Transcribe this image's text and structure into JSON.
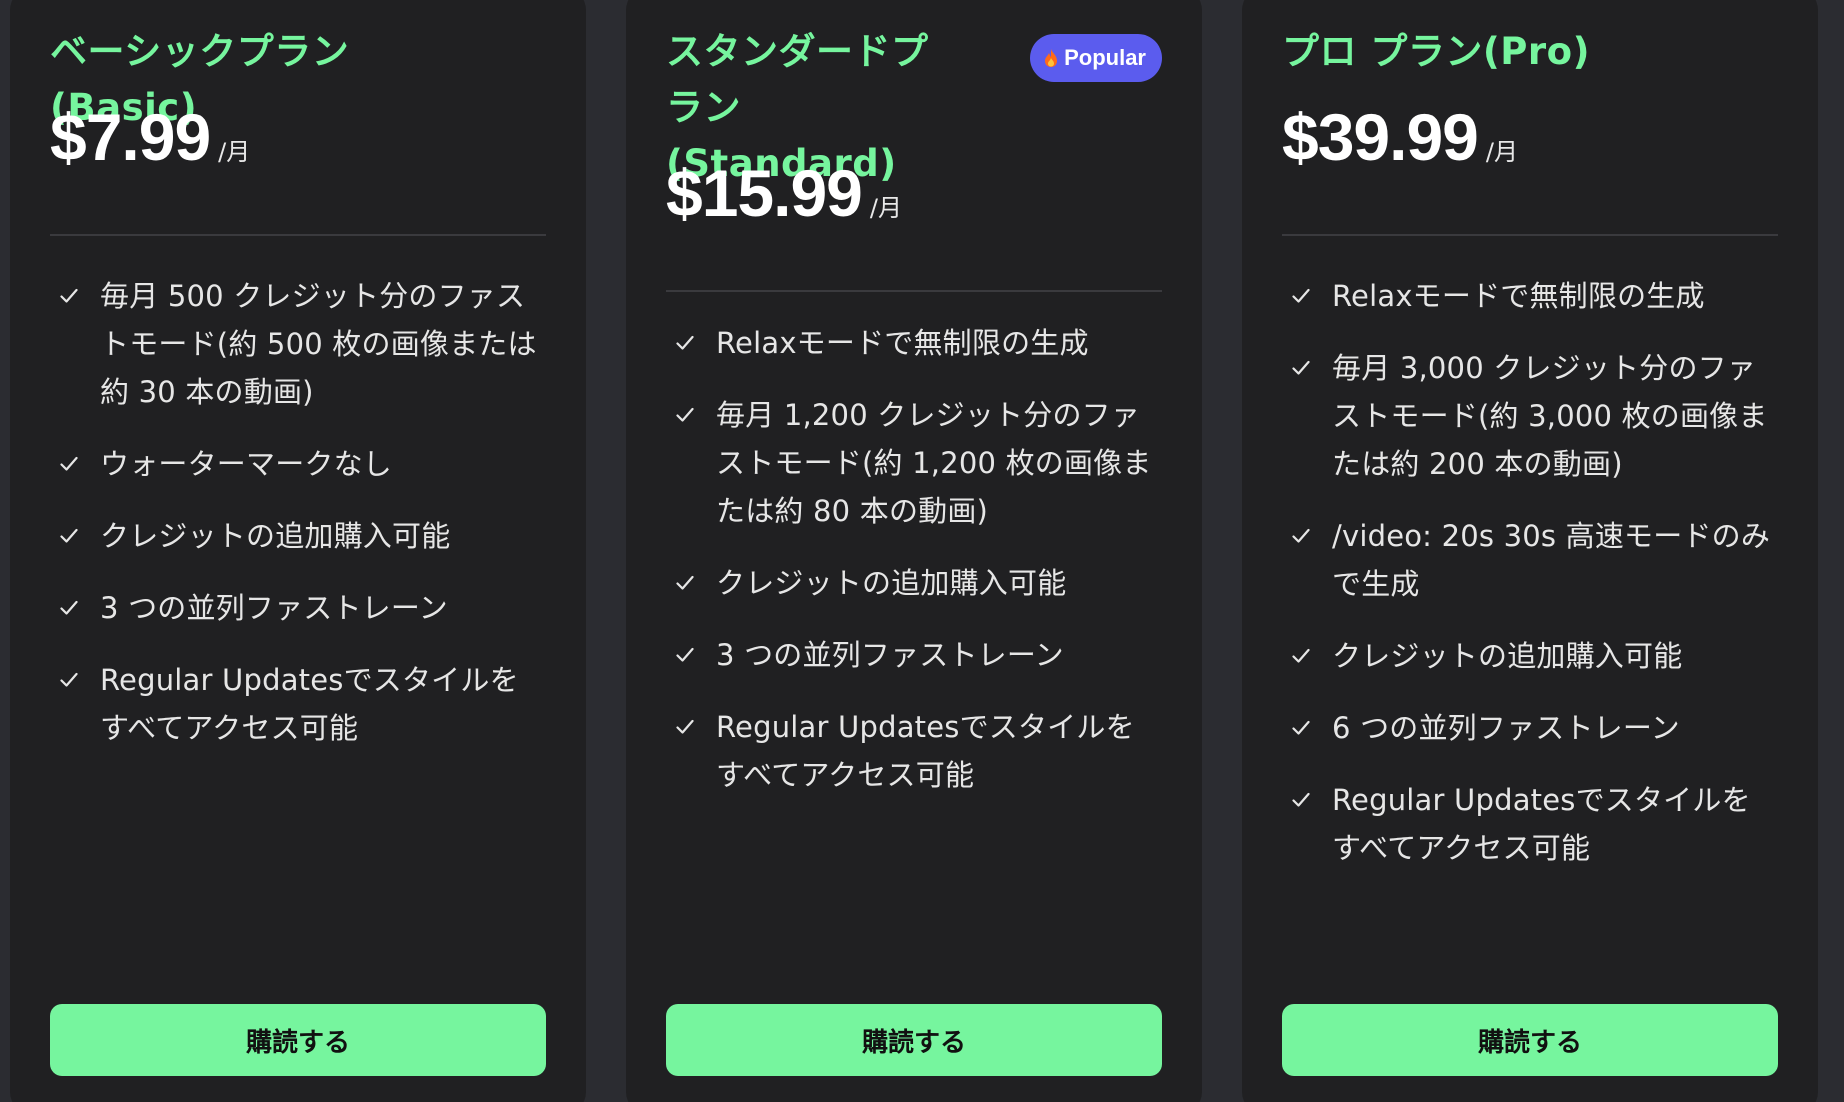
{
  "plans": [
    {
      "title": "ベーシックプラン(Basic)",
      "price": "$7.99",
      "per": "/月",
      "features": [
        "毎月 500 クレジット分のファストモード(約 500 枚の画像または約 30 本の動画)",
        "ウォーターマークなし",
        "クレジットの追加購入可能",
        "3 つの並列ファストレーン",
        "Regular Updatesでスタイルをすべてアクセス可能"
      ],
      "button": "購読する"
    },
    {
      "title": "スタンダードプラン(Standard)",
      "badge": "Popular",
      "badge_icon": "fire-icon",
      "price": "$15.99",
      "per": "/月",
      "features": [
        "Relaxモードで無制限の生成",
        "毎月 1,200 クレジット分のファストモード(約 1,200 枚の画像または約 80 本の動画)",
        "クレジットの追加購入可能",
        "3 つの並列ファストレーン",
        "Regular Updatesでスタイルをすべてアクセス可能"
      ],
      "button": "購読する"
    },
    {
      "title": "プロ プラン(Pro)",
      "price": "$39.99",
      "per": "/月",
      "features": [
        "Relaxモードで無制限の生成",
        "毎月 3,000 クレジット分のファストモード(約 3,000 枚の画像または約 200 本の動画)",
        "/video: 20s 30s 高速モードのみで生成",
        "クレジットの追加購入可能",
        "6 つの並列ファストレーン",
        "Regular Updatesでスタイルをすべてアクセス可能"
      ],
      "button": "購読する"
    }
  ],
  "colors": {
    "accent": "#76f59e",
    "badge": "#5b5cee",
    "card": "#202022",
    "background": "#2b2c31"
  }
}
